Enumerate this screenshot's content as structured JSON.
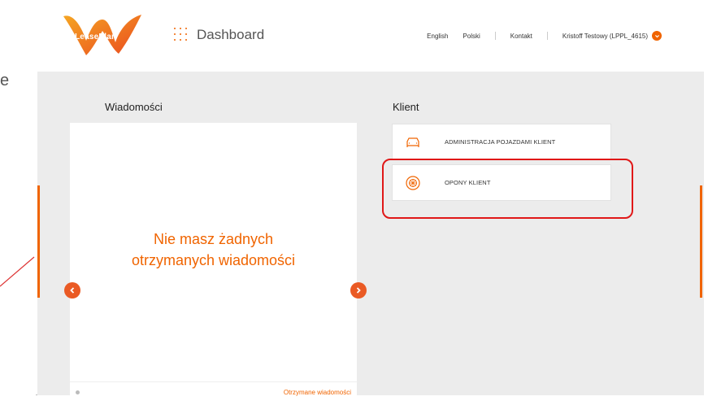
{
  "slide": {
    "stray_letter": "e"
  },
  "header": {
    "logo_text": "LeasePlan",
    "section_title": "Dashboard",
    "nav": [
      {
        "label": "English"
      },
      {
        "label": "Polski"
      },
      {
        "label": "Kontakt"
      },
      {
        "label": "Kristoff Testowy  (LPPL_4615)"
      }
    ]
  },
  "messages": {
    "title": "Wiadomości",
    "empty_line1": "Nie masz żadnych",
    "empty_line2": "otrzymanych wiadomości",
    "footer_link": "Otrzymane wiadomości"
  },
  "client": {
    "title": "Klient",
    "items": [
      {
        "label": "ADMINISTRACJA POJAZDAMI KLIENT",
        "icon": "car-icon"
      },
      {
        "label": "OPONY KLIENT",
        "icon": "tyre-icon"
      }
    ]
  },
  "colors": {
    "accent": "#f06400",
    "highlight": "#e01818",
    "content_bg": "#ececec"
  }
}
